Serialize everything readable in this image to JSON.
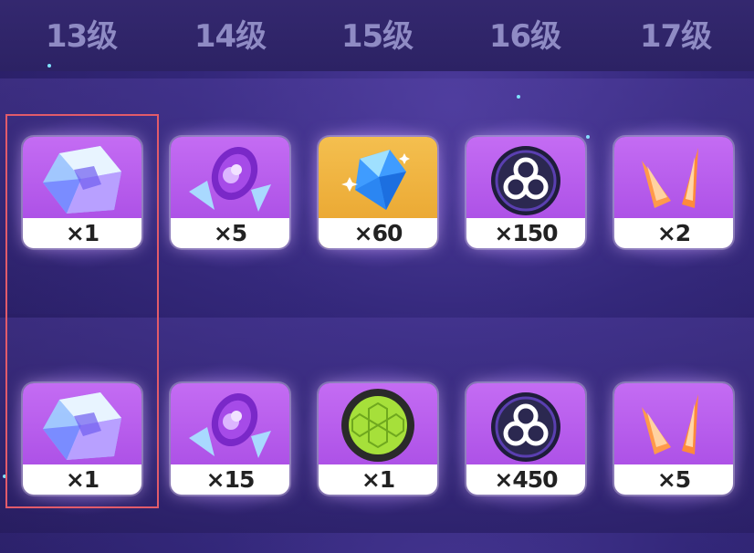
{
  "levels": [
    "13级",
    "14级",
    "15级",
    "16级",
    "17级"
  ],
  "rows": [
    [
      {
        "icon": "prism-cube-icon",
        "qty": "×1"
      },
      {
        "icon": "purple-crystal-token-icon",
        "qty": "×5"
      },
      {
        "icon": "blue-crystal-icon",
        "qty": "×60"
      },
      {
        "icon": "triskelion-medal-icon",
        "qty": "×150"
      },
      {
        "icon": "amber-shards-icon",
        "qty": "×2"
      }
    ],
    [
      {
        "icon": "prism-cube-icon",
        "qty": "×1"
      },
      {
        "icon": "purple-crystal-token-icon",
        "qty": "×15"
      },
      {
        "icon": "green-hex-orb-icon",
        "qty": "×1"
      },
      {
        "icon": "triskelion-medal-icon",
        "qty": "×450"
      },
      {
        "icon": "amber-shards-icon",
        "qty": "×5"
      }
    ]
  ],
  "colors": {
    "selection_border": "#e25b6a",
    "card_purple": "#b85aec",
    "card_gold": "#f0b13a"
  }
}
